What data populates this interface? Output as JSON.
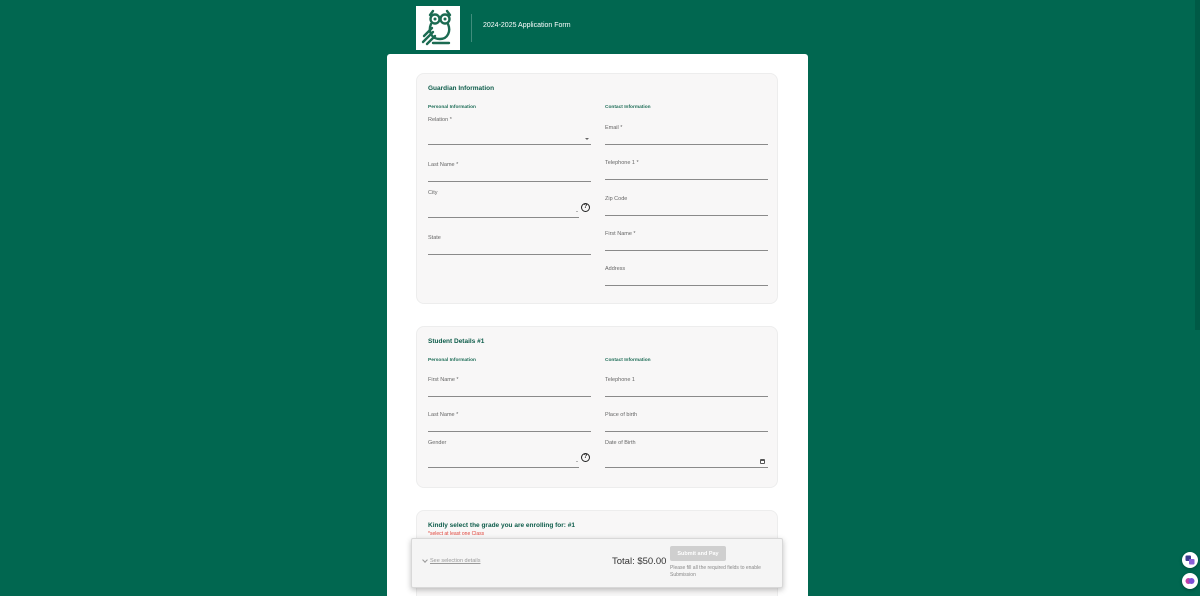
{
  "header": {
    "title": "2024-2025 Application Form",
    "logo_icon": "owl-logo-icon"
  },
  "guardian": {
    "title": "Guardian Information",
    "personal_label": "Personal Information",
    "contact_label": "Contact Information",
    "relation": "Relation *",
    "last_name": "Last Name *",
    "city": "City",
    "state": "State",
    "email": "Email *",
    "telephone1": "Telephone 1 *",
    "zip": "Zip Code",
    "first_name": "First Name *",
    "address": "Address",
    "help_glyph": "?",
    "dash": "-"
  },
  "student": {
    "title": "Student Details #1",
    "personal_label": "Personal Information",
    "contact_label": "Contact Information",
    "first_name": "First Name *",
    "last_name": "Last Name *",
    "gender": "Gender",
    "telephone1": "Telephone 1",
    "place_of_birth": "Place of birth",
    "date_of_birth": "Date of Birth",
    "help_glyph": "?",
    "dash": "-"
  },
  "grade": {
    "title": "Kindly select the grade you are enrolling for: #1",
    "note": "*select at least one Class"
  },
  "footer": {
    "see_details": "See selection details",
    "total": "Total: $50.00",
    "submit_label": "Submit and Pay",
    "hint": "Please fill all the required fields to enable Submission"
  },
  "colors": {
    "background": "#016750",
    "accent_text": "#0d5c4a",
    "required": "#e0443a",
    "button_disabled": "#cfcfcf"
  }
}
